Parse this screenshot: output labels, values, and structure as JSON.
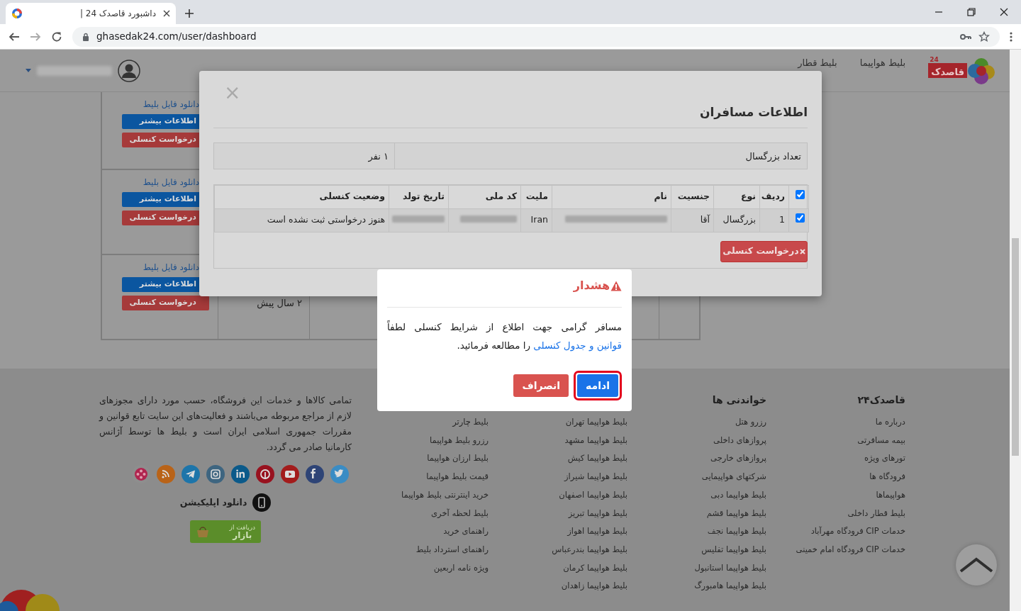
{
  "browser": {
    "tab_title": "داشبورد قاصدک 24 |",
    "url": "ghasedak24.com/user/dashboard"
  },
  "navbar": {
    "logo_text": "قاصدک",
    "logo_number": "24",
    "items": [
      "بلیط هواپیما",
      "بلیط قطار"
    ]
  },
  "tickets": [
    {
      "download_link": "دانلود فایل بلیط",
      "info_button": "اطلاعات بیشتر",
      "cancel_button": "درخواست کنسلی"
    },
    {
      "download_link": "دانلود فایل بلیط",
      "info_button": "اطلاعات بیشتر",
      "cancel_button": "درخواست کنسلی"
    },
    {
      "download_link": "دانلود فایل بلیط",
      "info_button": "اطلاعات بیشتر",
      "cancel_button": "درخواست کنسلی",
      "age": "۲ سال پیش"
    }
  ],
  "passenger_modal": {
    "close": "×",
    "title": "اطلاعات مسافران",
    "adult_count_label": "تعداد بزرگسال",
    "adult_count_value": "۱ نفر",
    "all_checked": true,
    "columns": [
      "ردیف",
      "نوع",
      "جنسیت",
      "نام",
      "ملیت",
      "کد ملی",
      "تاریخ تولد",
      "وضعیت کنسلی"
    ],
    "rows": [
      {
        "checked": true,
        "cells": [
          {
            "kind": "text",
            "text": "1"
          },
          {
            "kind": "text",
            "text": "بزرگسال"
          },
          {
            "kind": "text",
            "text": "آقا"
          },
          {
            "kind": "blurred"
          },
          {
            "kind": "text",
            "text": "Iran"
          },
          {
            "kind": "blurred"
          },
          {
            "kind": "blurred"
          },
          {
            "kind": "text",
            "text": "هنوز درخواستی ثبت نشده است"
          }
        ]
      }
    ],
    "cancel_button": "درخواست کنسلی"
  },
  "alert": {
    "title": "هشدار",
    "text_before": "مسافر گرامی جهت اطلاع از شرایط کنسلی لطفاً",
    "link": "قوانین و جدول کنسلی",
    "text_after": "را مطالعه فرمائید.",
    "buttons": [
      {
        "label": "ادامه",
        "kind": "primary",
        "highlighted": true
      },
      {
        "label": "انصراف",
        "kind": "danger",
        "highlighted": false
      }
    ]
  },
  "footer": {
    "columns": [
      {
        "heading": "قاصدک۲۴",
        "links": [
          "درباره ما",
          "بیمه مسافرتی",
          "تورهای ویژه",
          "فرودگاه ها",
          "هواپیماها",
          "بلیط قطار داخلی",
          "خدمات CIP فرودگاه مهرآباد",
          "خدمات CIP فرودگاه امام خمینی"
        ]
      },
      {
        "heading": "خواندنی ها",
        "links": [
          "رزرو هتل",
          "پروازهای داخلی",
          "پروازهای خارجی",
          "شرکتهای هواپیمایی",
          "بلیط هواپیما دبی",
          "بلیط هواپیما قشم",
          "بلیط هواپیما نجف",
          "بلیط هواپیما تفلیس",
          "بلیط هواپیما استانبول",
          "بلیط هواپیما هامبورگ"
        ]
      },
      {
        "links": [
          "بلیط هواپیما تهران",
          "بلیط هواپیما مشهد",
          "بلیط هواپیما کیش",
          "بلیط هواپیما شیراز",
          "بلیط هواپیما اصفهان",
          "بلیط هواپیما تبریز",
          "بلیط هواپیما اهواز",
          "بلیط هواپیما بندرعباس",
          "بلیط هواپیما کرمان",
          "بلیط هواپیما زاهدان"
        ]
      },
      {
        "links": [
          "بلیط چارتر",
          "رزرو بلیط هواپیما",
          "بلیط ارزان هواپیما",
          "قیمت بلیط هواپیما",
          "خرید اینترنتی بلیط هواپیما",
          "بلیط لحظه آخری",
          "راهنمای خرید",
          "راهنمای استرداد بلیط",
          "ویژه نامه اربعین"
        ]
      }
    ],
    "about": "تمامی کالاها و خدمات این فروشگاه، حسب مورد دارای مجوزهای لازم از مراجع مربوطه می‌باشند و فعالیت‌های این سایت تابع قوانین و مقررات جمهوری اسلامی ایران است و بلیط ها توسط آژانس کارمانیا صادر می گردد.",
    "app_download": "دانلود اپلیکیشن",
    "bazaar_small": "دریافت از",
    "bazaar_name": "بازار"
  }
}
